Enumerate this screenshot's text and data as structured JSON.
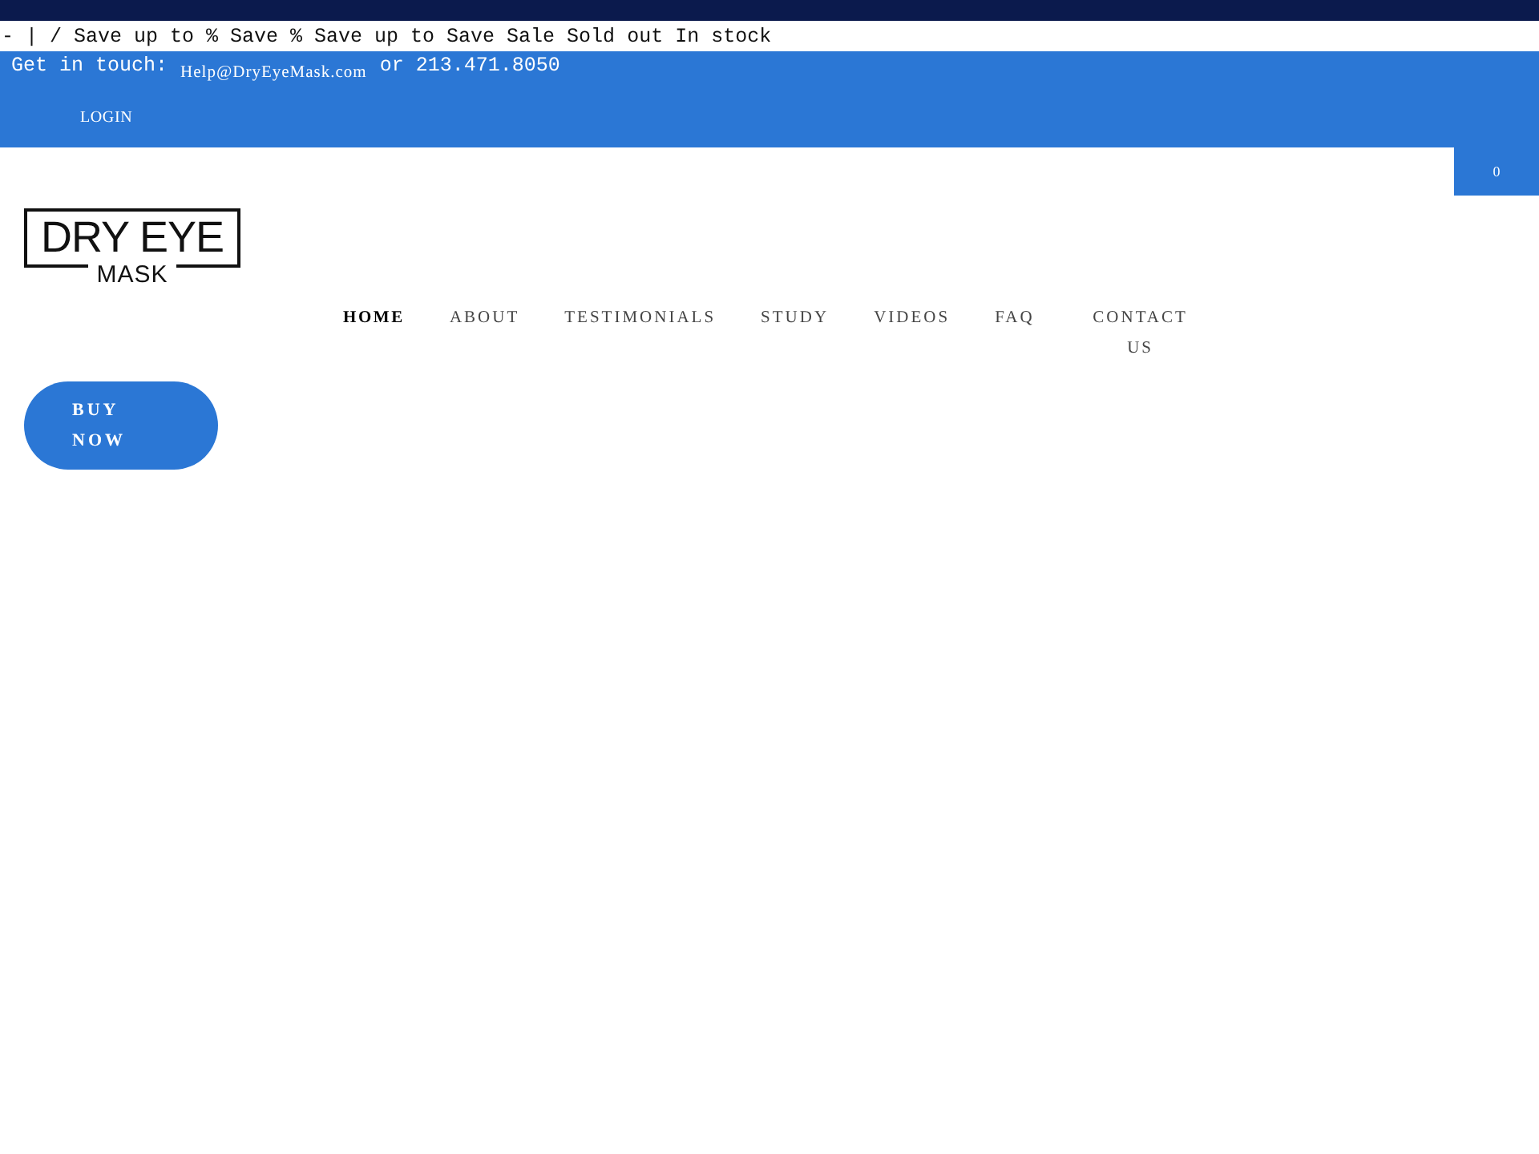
{
  "announcement": {
    "text": "- | / Save up to % Save % Save up to Save Sale Sold out In stock"
  },
  "contact_bar": {
    "label": "Get in touch:",
    "email": "Help@DryEyeMask.com",
    "phone_text": "or 213.471.8050",
    "login": "LOGIN"
  },
  "cart": {
    "count": "0"
  },
  "logo": {
    "line_1": "DRY EYE",
    "line_2": "MASK"
  },
  "nav": [
    {
      "label": "HOME",
      "selected": true
    },
    {
      "label": "ABOUT",
      "selected": false
    },
    {
      "label": "TESTIMONIALS",
      "selected": false
    },
    {
      "label": "STUDY",
      "selected": false
    },
    {
      "label": "VIDEOS",
      "selected": false
    },
    {
      "label": "FAQ",
      "selected": false
    },
    {
      "label": "CONTACT US",
      "selected": false
    }
  ],
  "buy_button": {
    "label": "BUY NOW"
  }
}
